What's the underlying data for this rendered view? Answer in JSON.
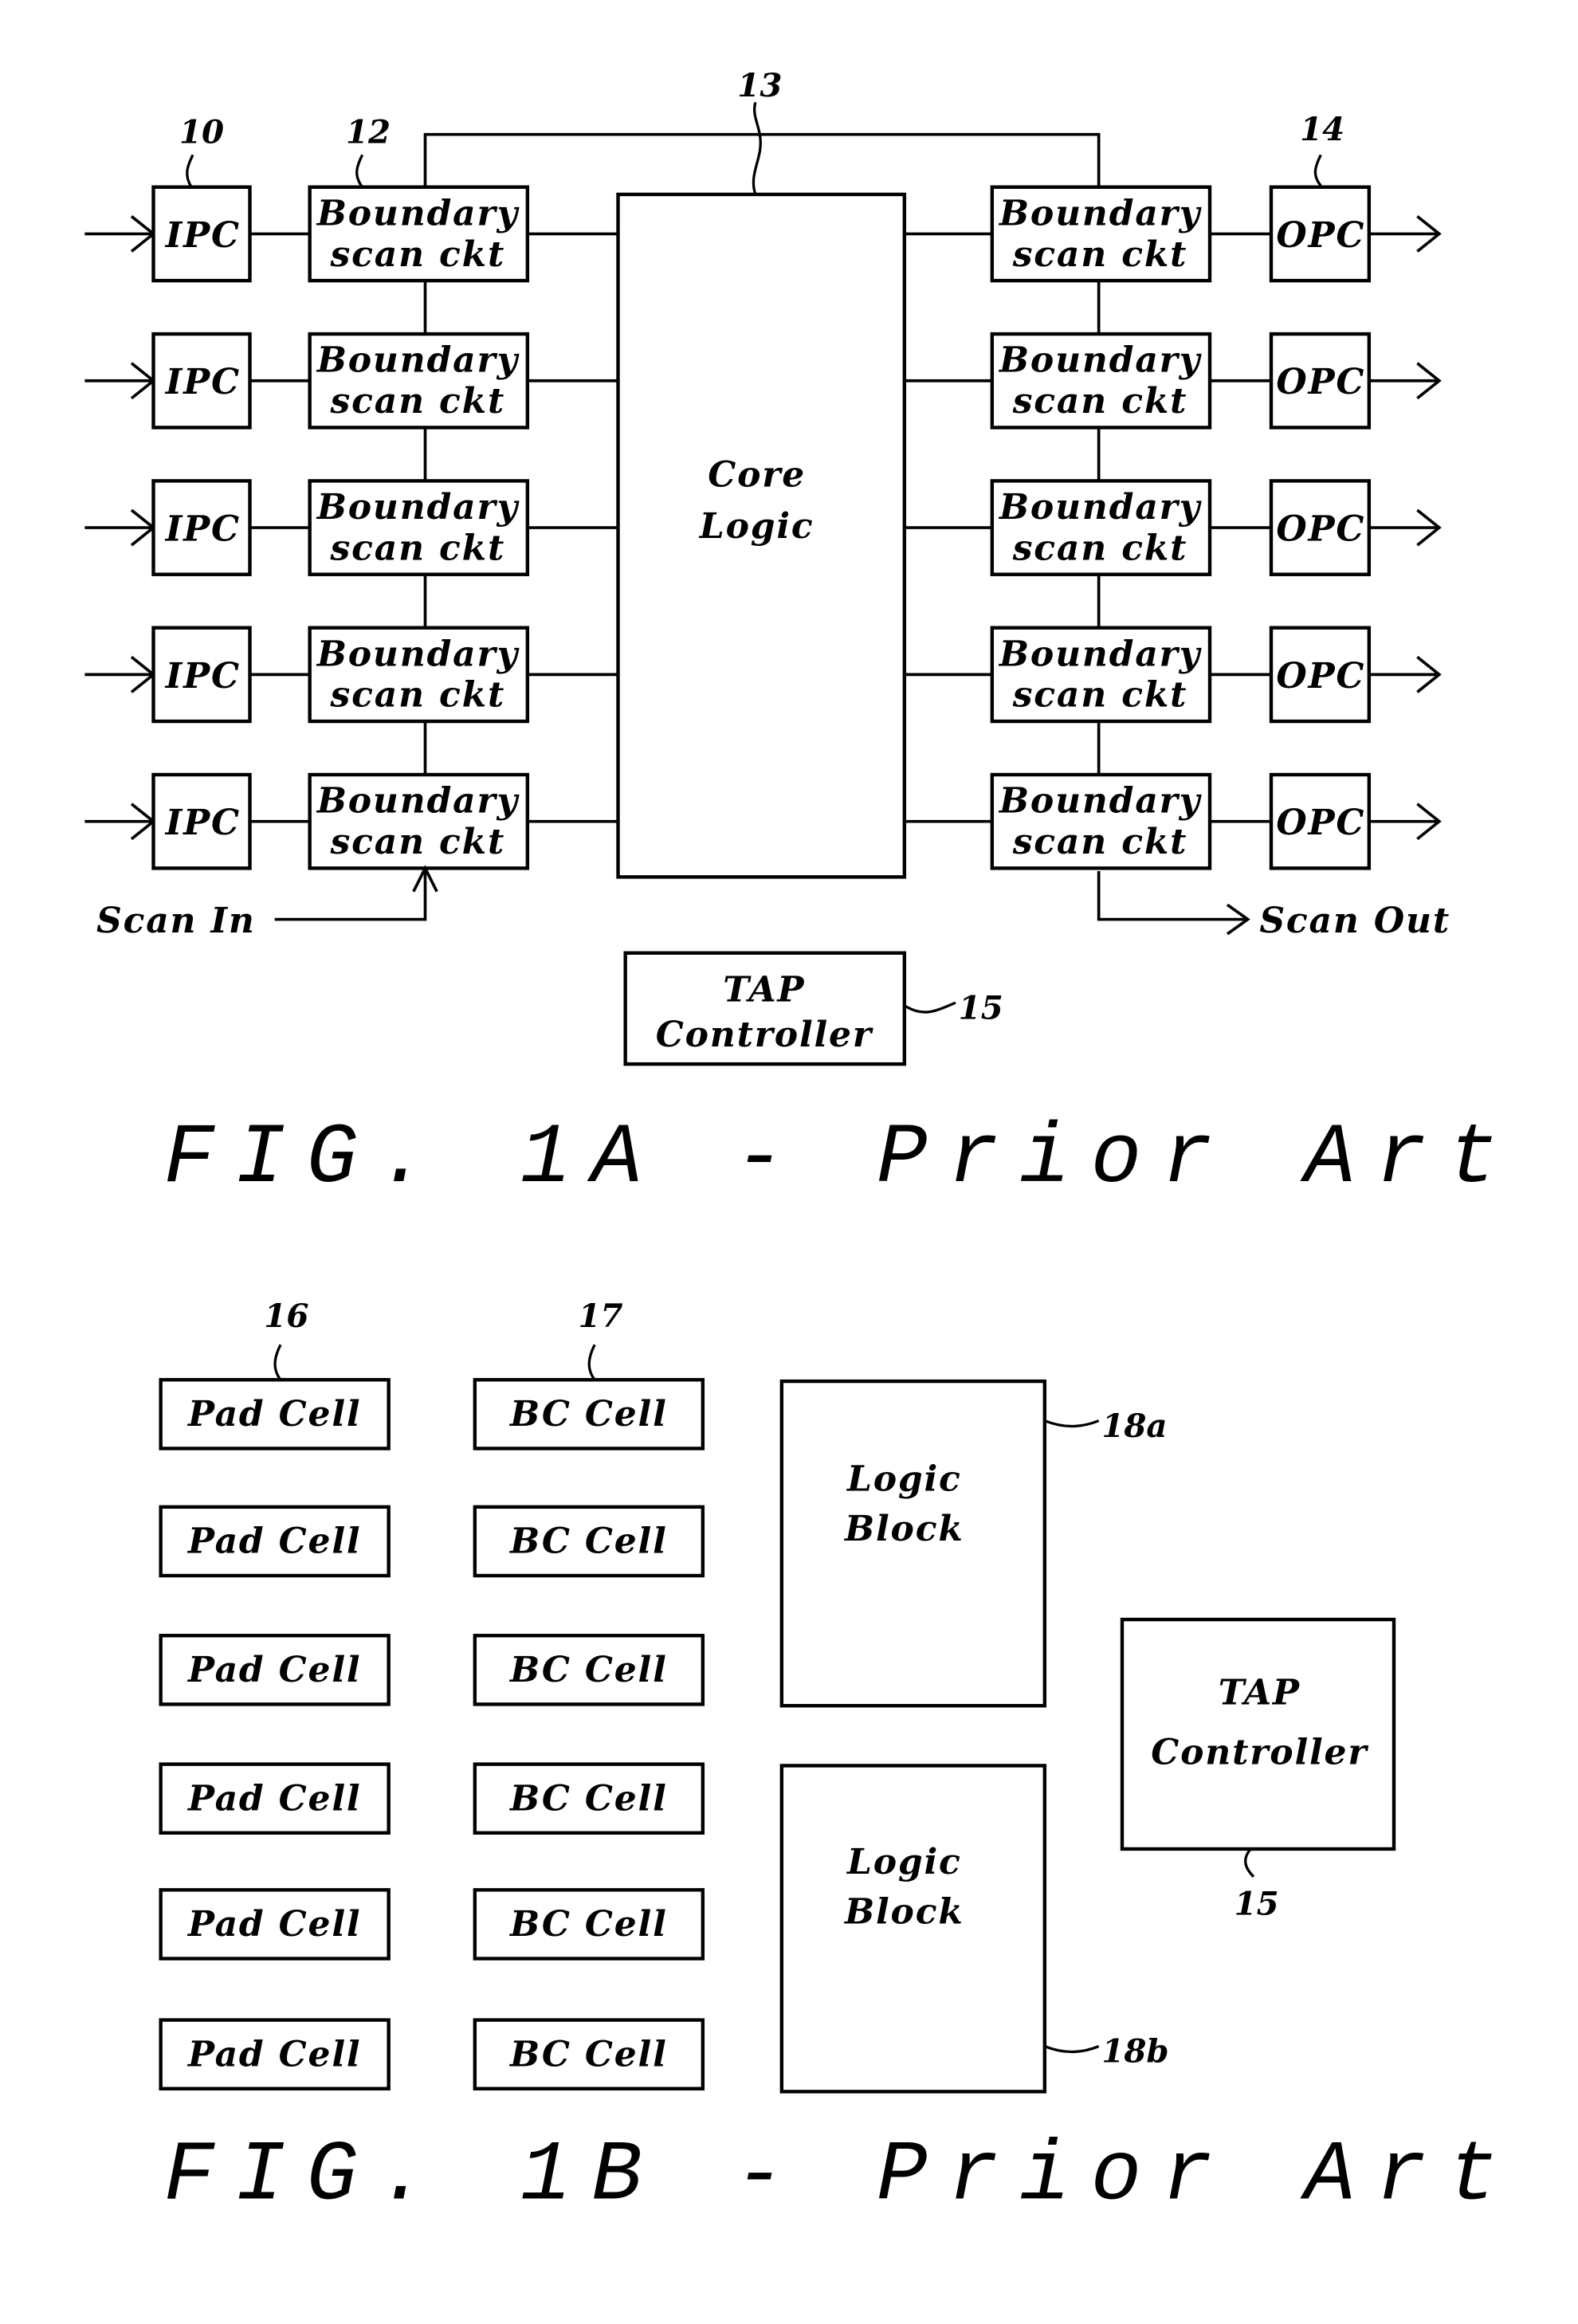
{
  "fig1a": {
    "caption": "FIG. 1A - Prior Art",
    "ipc_label": "IPC",
    "opc_label": "OPC",
    "bsc_line1": "Boundary",
    "bsc_line2": "scan ckt",
    "core_line1": "Core",
    "core_line2": "Logic",
    "tap_line1": "TAP",
    "tap_line2": "Controller",
    "scan_in": "Scan In",
    "scan_out": "Scan Out",
    "refs": {
      "ipc": "10",
      "bsc": "12",
      "core": "13",
      "opc": "14",
      "tap": "15"
    },
    "rows": 5
  },
  "fig1b": {
    "caption": "FIG. 1B - Prior Art",
    "pad_label": "Pad Cell",
    "bc_label": "BC Cell",
    "logic_line1": "Logic",
    "logic_line2": "Block",
    "tap_line1": "TAP",
    "tap_line2": "Controller",
    "refs": {
      "pad": "16",
      "bc": "17",
      "logic_a": "18a",
      "logic_b": "18b",
      "tap": "15"
    },
    "rows": 6
  }
}
